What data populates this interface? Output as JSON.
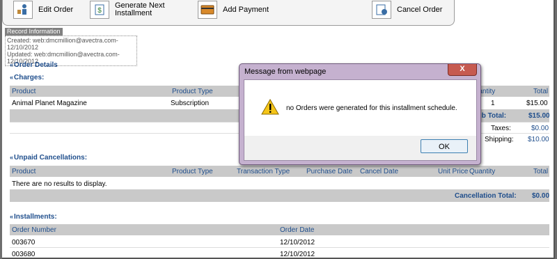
{
  "toolbar": {
    "edit_order": "Edit Order",
    "generate_next": "Generate Next Installment",
    "add_payment": "Add Payment",
    "cancel_order": "Cancel Order"
  },
  "record_info": {
    "title": "Record Information",
    "created": "Created: web:dmcmillion@avectra.com-12/10/2012",
    "updated": "Updated: web:dmcmillion@avectra.com-12/10/2012"
  },
  "order_details": {
    "title": "Order Details",
    "charges_title": "Charges:",
    "columns": {
      "product": "Product",
      "product_type": "Product Type",
      "quantity": "Quantity",
      "total": "Total"
    },
    "row": {
      "product": "Animal Planet Magazine",
      "product_type": "Subscription",
      "quantity": "1",
      "total": "$15.00"
    },
    "subtotal_label": "Sub Total:",
    "subtotal_value": "$15.00",
    "taxes_label": "Taxes:",
    "taxes_value": "$0.00",
    "shipping_label": "Shipping:",
    "shipping_value": "$10.00"
  },
  "unpaid_cancellations": {
    "title": "Unpaid Cancellations:",
    "columns": {
      "product": "Product",
      "product_type": "Product Type",
      "transaction_type": "Transaction Type",
      "purchase_date": "Purchase Date",
      "cancel_date": "Cancel Date",
      "unit_price": "Unit Price",
      "quantity": "Quantity",
      "total": "Total"
    },
    "empty": "There are no results to display.",
    "total_label": "Cancellation Total:",
    "total_value": "$0.00"
  },
  "installments": {
    "title": "Installments:",
    "columns": {
      "order_number": "Order Number",
      "order_date": "Order Date"
    },
    "rows": [
      {
        "order_number": "003670",
        "order_date": "12/10/2012"
      },
      {
        "order_number": "003680",
        "order_date": "12/10/2012"
      }
    ]
  },
  "dialog": {
    "title": "Message from webpage",
    "close": "X",
    "message": "no Orders were generated for this installment schedule.",
    "ok": "OK"
  },
  "colors": {
    "accent": "#1f4e8c",
    "header_bg": "#c9c9c9",
    "dialog_frame": "#c5b1cf"
  }
}
